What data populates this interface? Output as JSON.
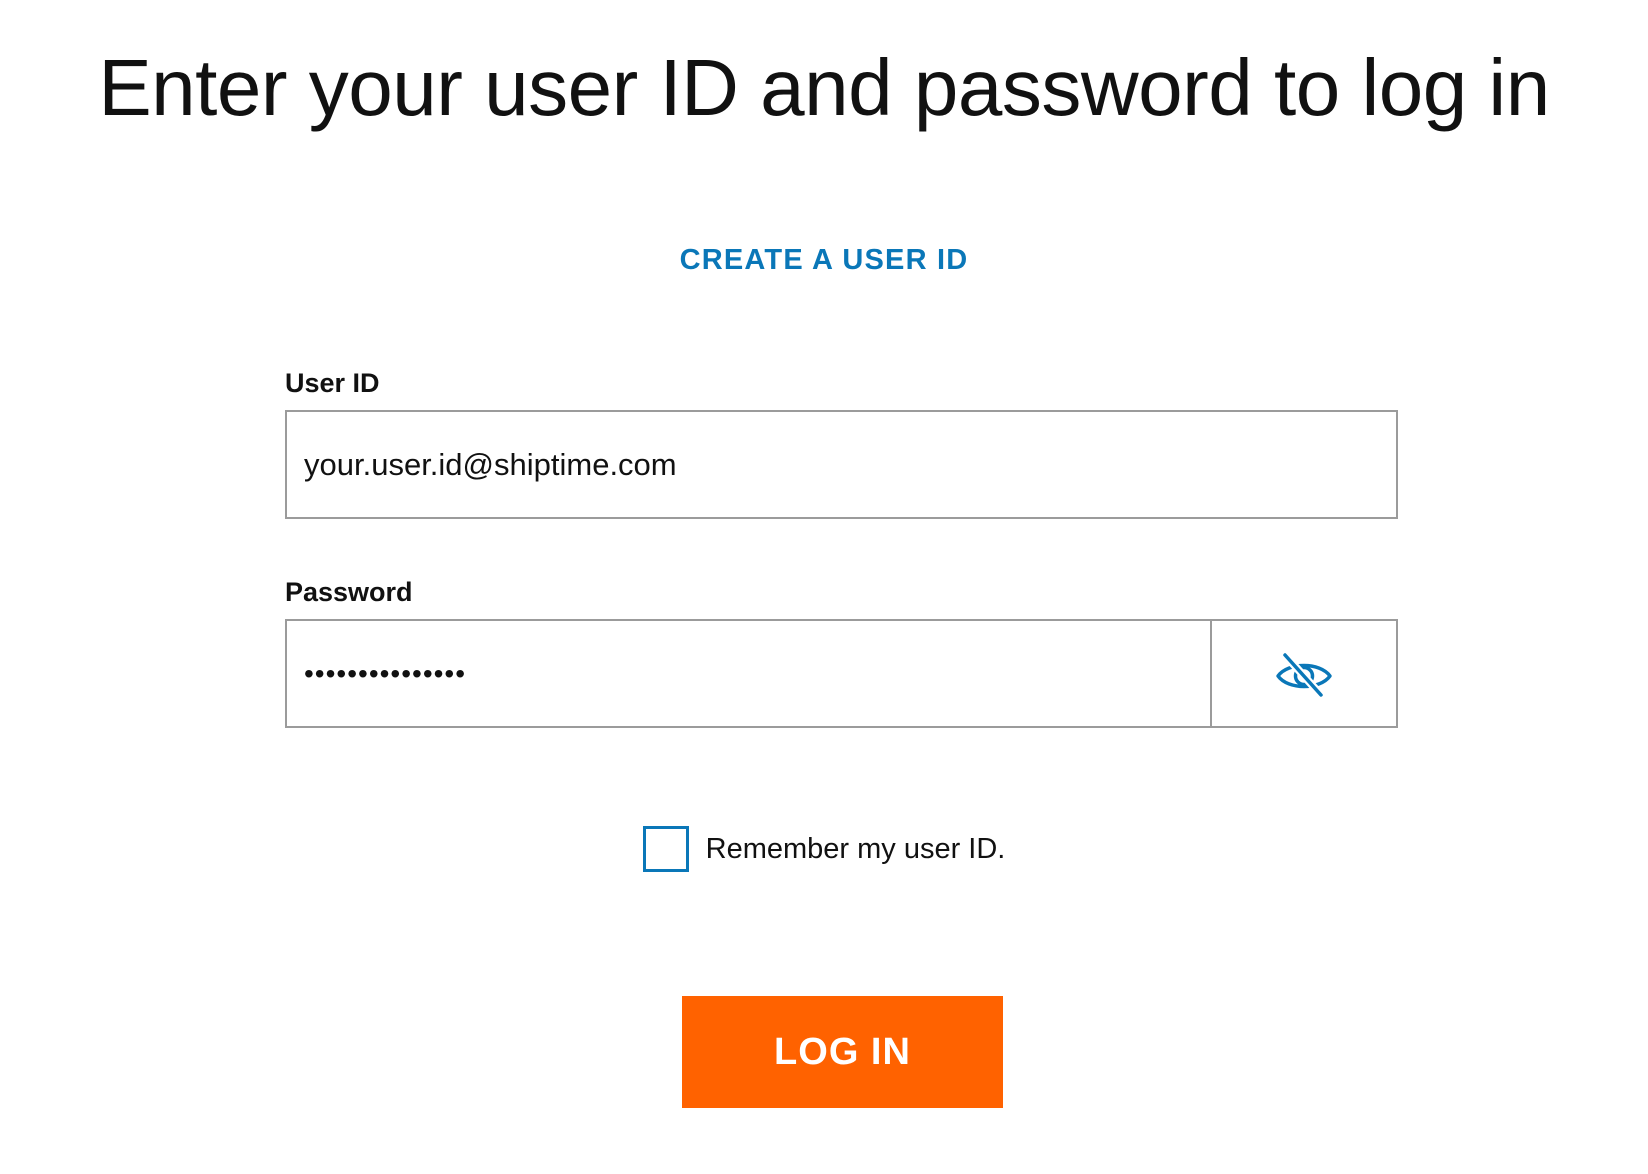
{
  "header": {
    "title": "Enter your user ID and password to log in"
  },
  "links": {
    "create_user_id": "CREATE A USER ID"
  },
  "form": {
    "user_id_label": "User ID",
    "user_id_value": "your.user.id@shiptime.com",
    "password_label": "Password",
    "password_value": "•••••••••••••••",
    "password_toggle_icon": "eye-slash-icon",
    "remember_label": "Remember my user ID.",
    "remember_checked": false,
    "login_label": "LOG IN"
  },
  "colors": {
    "accent": "#0a77b8",
    "primary_button": "#ff6200",
    "border": "#9b9b9b"
  }
}
